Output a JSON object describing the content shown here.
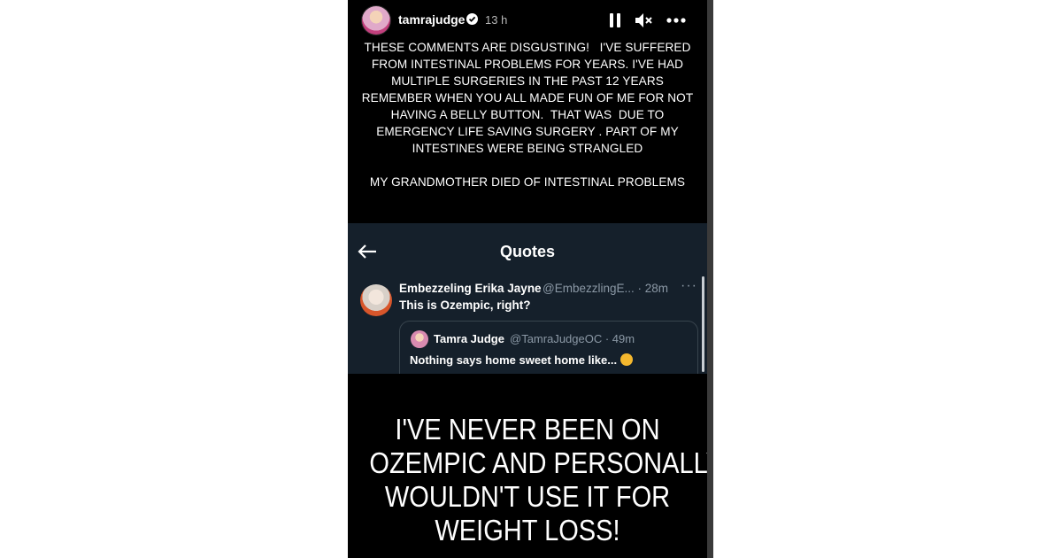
{
  "story": {
    "username": "tamrajudge",
    "time": "13 h",
    "icons": {
      "avatar": "profile-avatar",
      "verified": "verified-badge-icon",
      "pause": "pause-icon",
      "mute": "muted-speaker-icon",
      "more": "more-options-icon"
    },
    "caption_lines": [
      "THESE COMMENTS ARE DISGUSTING!   I'VE SUFFERED",
      "FROM INTESTINAL PROBLEMS FOR YEARS. I'VE HAD",
      "MULTIPLE SURGERIES IN THE PAST 12 YEARS",
      "REMEMBER WHEN YOU ALL MADE FUN OF ME FOR NOT",
      "HAVING A BELLY BUTTON.  THAT WAS  DUE TO",
      "EMERGENCY LIFE SAVING SURGERY . PART OF MY",
      "INTESTINES WERE BEING STRANGLED"
    ],
    "caption_last_line": "MY GRANDMOTHER DIED OF INTESTINAL PROBLEMS",
    "big_text_lines": [
      "I'VE NEVER BEEN ON",
      "OZEMPIC AND PERSONALLY",
      "WOULDN'T USE IT FOR",
      "WEIGHT LOSS!"
    ]
  },
  "embed": {
    "title": "Quotes",
    "tweet": {
      "name": "Embezzeling Erika Jayne",
      "handle_time": "@EmbezzlingE... · 28m",
      "more": "···",
      "text": "This is Ozempic, right?"
    },
    "quoted": {
      "name": "Tamra Judge",
      "handle_time": "@TamraJudgeOC · 49m",
      "text": "Nothing says home sweet home like..."
    }
  }
}
